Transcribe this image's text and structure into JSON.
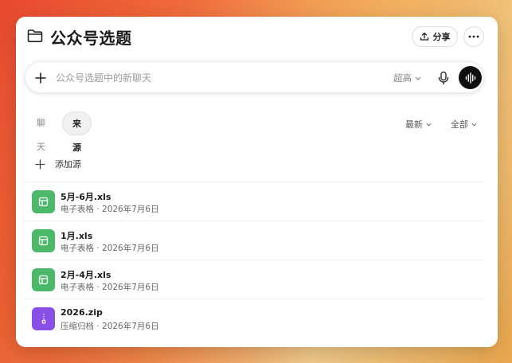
{
  "window": {
    "title": "公众号选题",
    "share_label": "分享"
  },
  "composer": {
    "placeholder": "公众号选题中的新聊天",
    "model": "超高"
  },
  "tabs": [
    {
      "label": "聊天",
      "active": false
    },
    {
      "label": "来源",
      "active": true
    }
  ],
  "filters": {
    "sort": "最新",
    "type": "全部"
  },
  "add_source_label": "添加源",
  "files": [
    {
      "name": "5月-6月.xls",
      "meta": "电子表格 · 2026年7月6日",
      "icon": "spreadsheet-icon",
      "color": "#4cb86a"
    },
    {
      "name": "1月.xls",
      "meta": "电子表格 · 2026年7月6日",
      "icon": "spreadsheet-icon",
      "color": "#4cb86a"
    },
    {
      "name": "2月-4月.xls",
      "meta": "电子表格 · 2026年7月6日",
      "icon": "spreadsheet-icon",
      "color": "#4cb86a"
    },
    {
      "name": "2026.zip",
      "meta": "压缩归档 · 2026年7月6日",
      "icon": "archive-icon",
      "color": "#8a4fe6"
    }
  ]
}
